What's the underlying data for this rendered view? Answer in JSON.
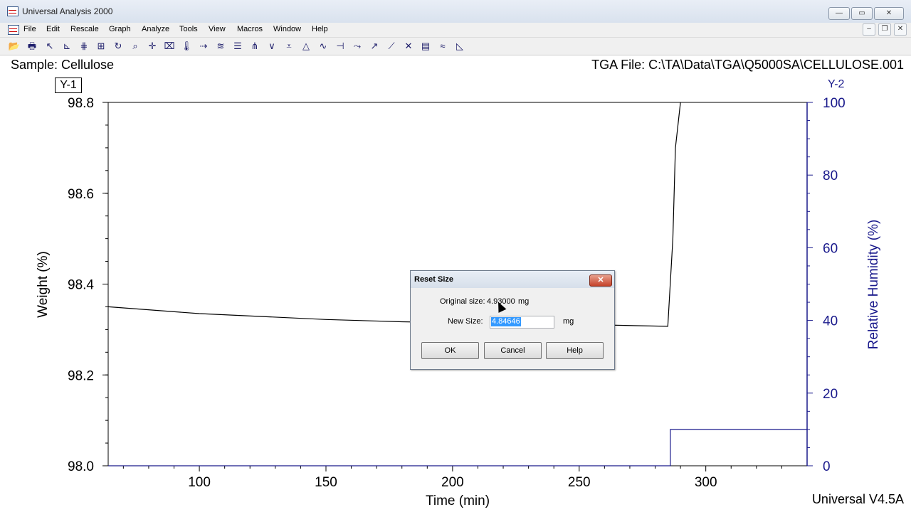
{
  "window": {
    "title": "Universal Analysis 2000",
    "minimize": "—",
    "maximize": "▭",
    "close": "✕"
  },
  "menu": {
    "items": [
      "File",
      "Edit",
      "Rescale",
      "Graph",
      "Analyze",
      "Tools",
      "View",
      "Macros",
      "Window",
      "Help"
    ]
  },
  "mdi": {
    "minimize": "–",
    "restore": "❐",
    "close": "✕"
  },
  "toolbar": {
    "icons": [
      "open-icon",
      "print-icon",
      "cursor-icon",
      "graph-icon",
      "rescale-icon",
      "rescale-x-icon",
      "rotate-icon",
      "zoom-icon",
      "crosshair-icon",
      "full-scale-icon",
      "thermometer-icon",
      "tool-icon",
      "auto-icon",
      "list-icon",
      "filter-icon",
      "peak-icon",
      "valley-icon",
      "triangle-icon",
      "wave-icon",
      "step-icon",
      "line-icon",
      "arrow-icon",
      "slope-icon",
      "cross-icon",
      "table-icon",
      "signal-icon",
      "plot-icon"
    ]
  },
  "header": {
    "sample": "Sample: Cellulose",
    "file": "TGA File: C:\\TA\\Data\\TGA\\Q5000SA\\CELLULOSE.001"
  },
  "footer": {
    "version": "Universal V4.5A"
  },
  "chart_data": {
    "type": "line",
    "xlabel": "Time (min)",
    "ylabel": "Weight (%)",
    "y2label": "Relative Humidity (%)",
    "y1_tag": "Y-1",
    "y2_tag": "Y-2",
    "xlim": [
      64,
      340
    ],
    "ylim": [
      98.0,
      98.8
    ],
    "y2lim": [
      0,
      100
    ],
    "xticks": [
      100,
      150,
      200,
      250,
      300
    ],
    "yticks": [
      98.0,
      98.2,
      98.4,
      98.6,
      98.8
    ],
    "y2ticks": [
      0,
      20,
      40,
      60,
      80,
      100
    ],
    "series": [
      {
        "axis": "y1",
        "color": "#000000",
        "x": [
          64,
          100,
          150,
          180,
          200,
          230,
          260,
          285,
          287,
          288,
          290
        ],
        "y": [
          98.35,
          98.335,
          98.322,
          98.317,
          98.315,
          98.313,
          98.31,
          98.307,
          98.5,
          98.7,
          98.8
        ]
      },
      {
        "axis": "y2",
        "color": "#1a1a8c",
        "x": [
          64,
          286,
          286,
          340
        ],
        "y": [
          0,
          0,
          10,
          10
        ]
      }
    ]
  },
  "dialog": {
    "title": "Reset Size",
    "close": "✕",
    "original_label": "Original size:",
    "original_value": "4.93000",
    "original_unit": "mg",
    "new_label": "New Size:",
    "new_value": "4.84646",
    "new_unit": "mg",
    "ok": "OK",
    "cancel": "Cancel",
    "help": "Help"
  }
}
